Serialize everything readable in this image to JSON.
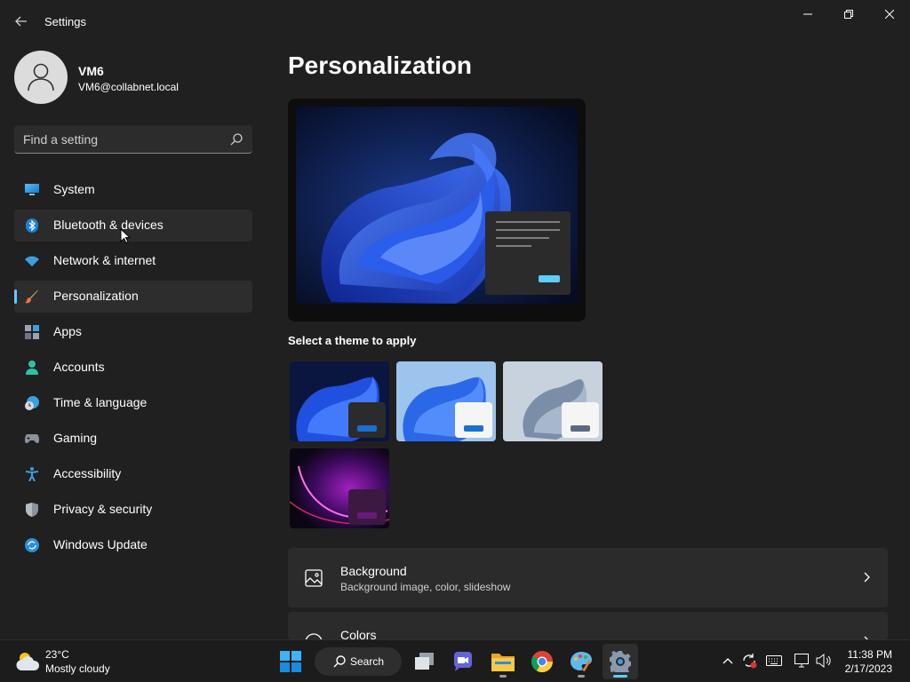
{
  "window": {
    "title": "Settings"
  },
  "profile": {
    "name": "VM6",
    "email": "VM6@collabnet.local"
  },
  "search": {
    "placeholder": "Find a setting"
  },
  "nav": {
    "items": [
      {
        "label": "System",
        "icon": "system-icon",
        "state": "normal"
      },
      {
        "label": "Bluetooth & devices",
        "icon": "bluetooth-icon",
        "state": "hover"
      },
      {
        "label": "Network & internet",
        "icon": "wifi-icon",
        "state": "normal"
      },
      {
        "label": "Personalization",
        "icon": "brush-icon",
        "state": "selected"
      },
      {
        "label": "Apps",
        "icon": "apps-icon",
        "state": "normal"
      },
      {
        "label": "Accounts",
        "icon": "person-icon",
        "state": "normal"
      },
      {
        "label": "Time & language",
        "icon": "clock-globe-icon",
        "state": "normal"
      },
      {
        "label": "Gaming",
        "icon": "gamepad-icon",
        "state": "normal"
      },
      {
        "label": "Accessibility",
        "icon": "accessibility-icon",
        "state": "normal"
      },
      {
        "label": "Privacy & security",
        "icon": "shield-icon",
        "state": "normal"
      },
      {
        "label": "Windows Update",
        "icon": "sync-icon",
        "state": "normal"
      }
    ]
  },
  "main": {
    "title": "Personalization",
    "themes_heading": "Select a theme to apply",
    "themes": [
      {
        "name": "windows-dark",
        "accent": "#1a6fd0"
      },
      {
        "name": "windows-light",
        "accent": "#1a6fd0"
      },
      {
        "name": "glow",
        "accent": "#5a6a80"
      },
      {
        "name": "captured-motion",
        "accent": "#6a1a7a"
      }
    ],
    "cards": [
      {
        "title": "Background",
        "subtitle": "Background image, color, slideshow",
        "icon": "image-icon"
      },
      {
        "title": "Colors",
        "subtitle": "",
        "icon": "palette-icon"
      }
    ]
  },
  "taskbar": {
    "weather": {
      "temp": "23°C",
      "desc": "Mostly cloudy"
    },
    "search_label": "Search",
    "clock": {
      "time": "11:38 PM",
      "date": "2/17/2023"
    }
  },
  "colors": {
    "accent": "#60cdff",
    "background": "#202020"
  }
}
